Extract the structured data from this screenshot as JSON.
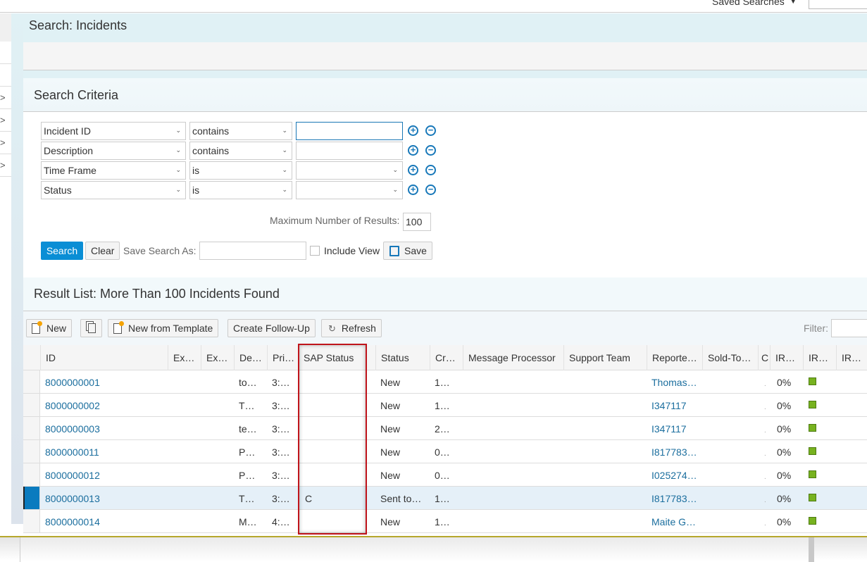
{
  "topbar": {
    "saved_searches_label": "Saved Searches"
  },
  "page_title": "Search: Incidents",
  "criteria": {
    "title": "Search Criteria",
    "rows": [
      {
        "field": "Incident ID",
        "operator": "contains",
        "value": "",
        "value_type": "text"
      },
      {
        "field": "Description",
        "operator": "contains",
        "value": "",
        "value_type": "text"
      },
      {
        "field": "Time Frame",
        "operator": "is",
        "value": "",
        "value_type": "select"
      },
      {
        "field": "Status",
        "operator": "is",
        "value": "",
        "value_type": "select"
      }
    ],
    "max_results_label": "Maximum Number of Results:",
    "max_results_value": "100",
    "search_label": "Search",
    "clear_label": "Clear",
    "save_search_as_label": "Save Search As:",
    "include_view_label": "Include View",
    "save_label": "Save"
  },
  "results": {
    "title": "Result List: More Than 100 Incidents Found",
    "toolbar": {
      "new_label": "New",
      "new_from_template_label": "New from Template",
      "create_follow_up_label": "Create Follow-Up",
      "refresh_label": "Refresh",
      "filter_label": "Filter:"
    },
    "columns": [
      "ID",
      "Ex…",
      "Ex…",
      "De…",
      "Pri…",
      "SAP Status",
      "Status",
      "Cr…",
      "Message Processor",
      "Support Team",
      "Reporte…",
      "Sold-To…",
      "C",
      "IR…",
      "IR…",
      "IR…"
    ],
    "rows": [
      {
        "id": "8000000001",
        "desc": "to…",
        "prio": "3:…",
        "sap_status": "",
        "status": "New",
        "created": "1…",
        "reporter": "Thomas…",
        "c": ".",
        "ir1": "0%",
        "lamp": "green"
      },
      {
        "id": "8000000002",
        "desc": "T…",
        "prio": "3:…",
        "sap_status": "",
        "status": "New",
        "created": "1…",
        "reporter": "I347117",
        "c": ".",
        "ir1": "0%",
        "lamp": "green"
      },
      {
        "id": "8000000003",
        "desc": "te…",
        "prio": "3:…",
        "sap_status": "",
        "status": "New",
        "created": "2…",
        "reporter": "I347117",
        "c": ".",
        "ir1": "0%",
        "lamp": "green"
      },
      {
        "id": "8000000011",
        "desc": "P…",
        "prio": "3:…",
        "sap_status": "",
        "status": "New",
        "created": "0…",
        "reporter": "I817783…",
        "c": ".",
        "ir1": "0%",
        "lamp": "green"
      },
      {
        "id": "8000000012",
        "desc": "P…",
        "prio": "3:…",
        "sap_status": "",
        "status": "New",
        "created": "0…",
        "reporter": "I025274…",
        "c": ".",
        "ir1": "0%",
        "lamp": "green"
      },
      {
        "id": "8000000013",
        "desc": "T…",
        "prio": "3:…",
        "sap_status": "C",
        "status": "Sent to…",
        "created": "1…",
        "reporter": "I817783…",
        "c": ".",
        "ir1": "0%",
        "lamp": "green",
        "selected": true
      },
      {
        "id": "8000000014",
        "desc": "M…",
        "prio": "4:…",
        "sap_status": "",
        "status": "New",
        "created": "1…",
        "reporter": "Maite G…",
        "c": ".",
        "ir1": "0%",
        "lamp": "green"
      }
    ]
  },
  "colors": {
    "accent": "#0a8ed5",
    "link": "#1b6e9e",
    "highlight_box": "#c0141b",
    "lamp_green": "#77b21f",
    "selected_row": "#e5f0f8"
  }
}
